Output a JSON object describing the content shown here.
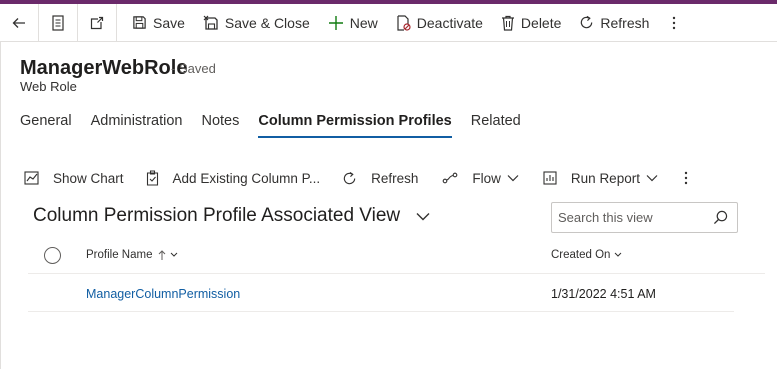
{
  "colors": {
    "accent_bar": "#6b2a6b",
    "link": "#115ea3",
    "tab_underline": "#115ea3"
  },
  "command_bar": {
    "icons": [
      "back-arrow-icon",
      "form-icon",
      "open-new-window-icon"
    ],
    "save_label": "Save",
    "save_close_label": "Save & Close",
    "new_label": "New",
    "deactivate_label": "Deactivate",
    "delete_label": "Delete",
    "refresh_label": "Refresh"
  },
  "header": {
    "title": "ManagerWebRole",
    "status": "- Saved",
    "entity": "Web Role"
  },
  "tabs": [
    {
      "label": "General"
    },
    {
      "label": "Administration"
    },
    {
      "label": "Notes"
    },
    {
      "label": "Column Permission Profiles",
      "active": true
    },
    {
      "label": "Related"
    }
  ],
  "subgrid_commands": {
    "show_chart": "Show Chart",
    "add_existing": "Add Existing Column P...",
    "refresh": "Refresh",
    "flow": "Flow",
    "run_report": "Run Report"
  },
  "view": {
    "title": "Column Permission Profile Associated View",
    "search_placeholder": "Search this view"
  },
  "grid": {
    "columns": [
      {
        "label": "Profile Name",
        "sort": "ascending"
      },
      {
        "label": "Created On"
      }
    ],
    "rows": [
      {
        "profile_name": "ManagerColumnPermission",
        "created_on": "1/31/2022 4:51 AM"
      }
    ]
  }
}
